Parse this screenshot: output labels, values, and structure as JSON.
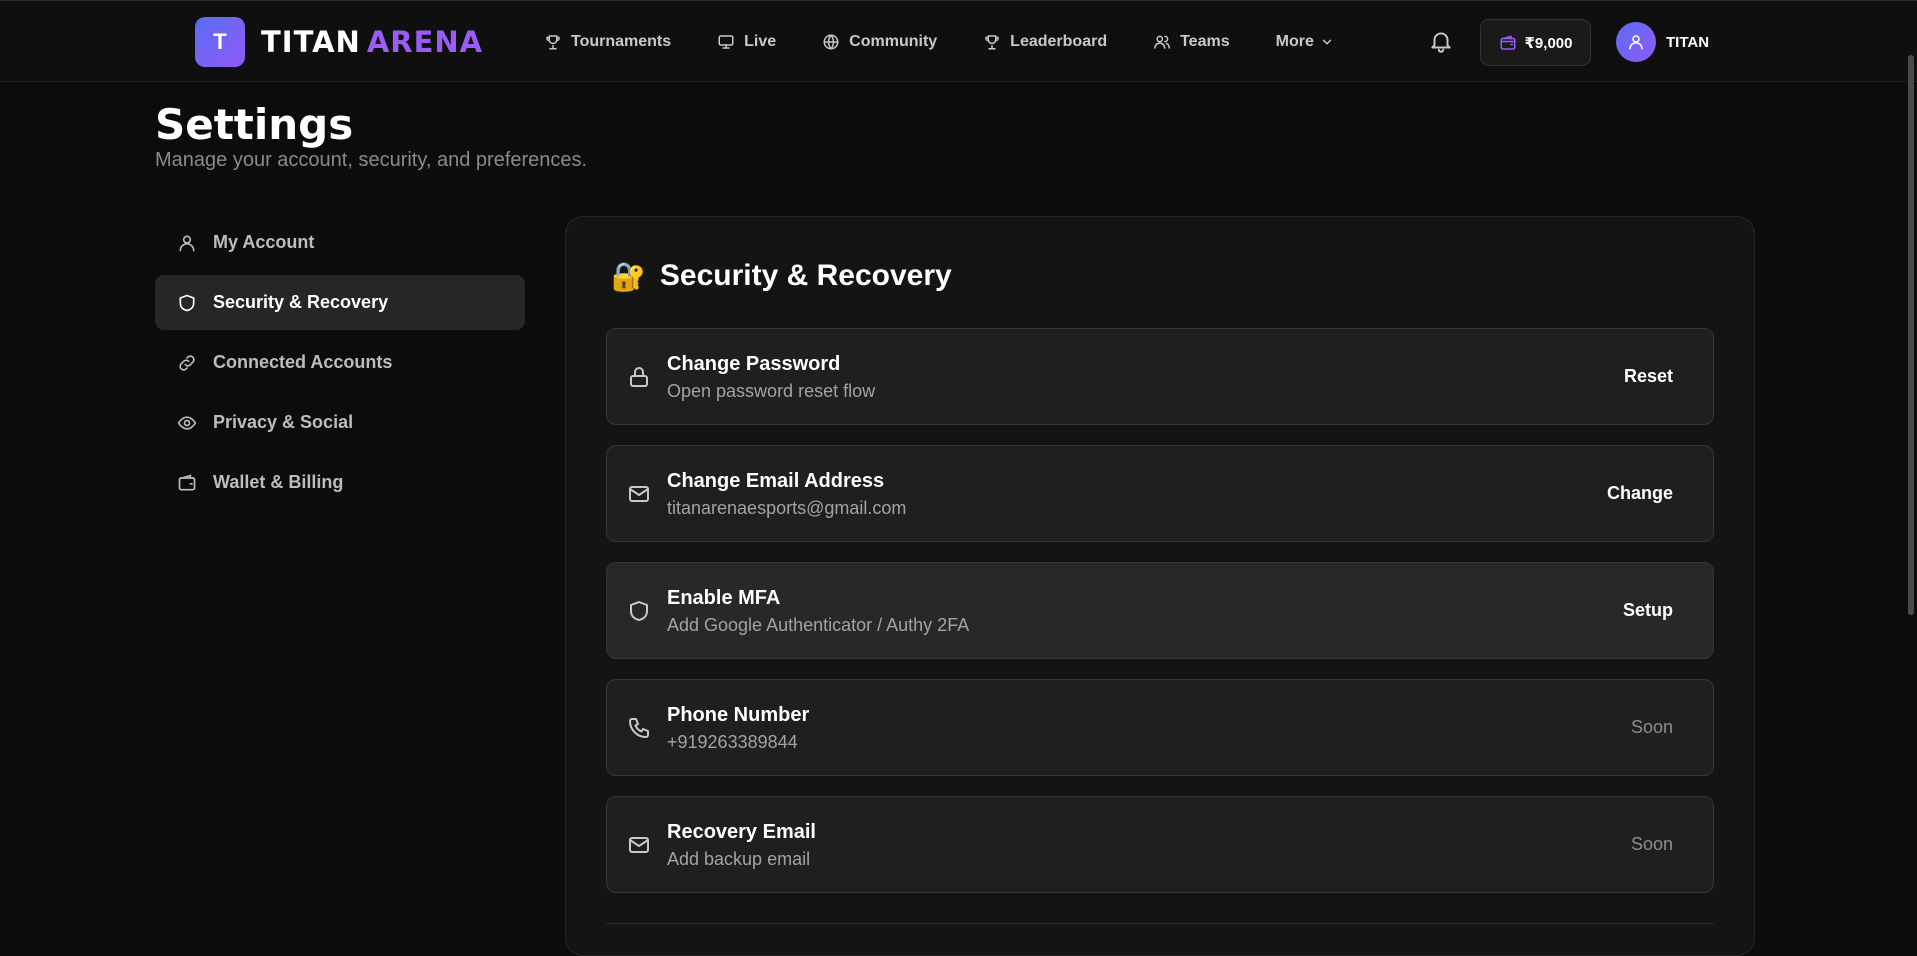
{
  "brand": {
    "mark": "T",
    "name_part1": "TITAN",
    "name_part2": "ARENA",
    "accent": "#9a5cf5"
  },
  "nav": {
    "items": [
      {
        "label": "Tournaments",
        "icon": "trophy-icon"
      },
      {
        "label": "Live",
        "icon": "monitor-icon"
      },
      {
        "label": "Community",
        "icon": "globe-icon"
      },
      {
        "label": "Leaderboard",
        "icon": "trophy-icon"
      },
      {
        "label": "Teams",
        "icon": "users-icon"
      },
      {
        "label": "More",
        "icon": "chevron-down-icon"
      }
    ],
    "wallet_balance": "₹9,000",
    "username": "TITAN"
  },
  "header": {
    "title": "Settings",
    "subtitle": "Manage your account, security, and preferences."
  },
  "sidebar": {
    "items": [
      {
        "label": "My Account",
        "icon": "user-icon",
        "active": false
      },
      {
        "label": "Security & Recovery",
        "icon": "shield-icon",
        "active": true
      },
      {
        "label": "Connected Accounts",
        "icon": "link-icon",
        "active": false
      },
      {
        "label": "Privacy & Social",
        "icon": "eye-icon",
        "active": false
      },
      {
        "label": "Wallet & Billing",
        "icon": "wallet-icon",
        "active": false
      }
    ]
  },
  "panel": {
    "emoji": "🔐",
    "title": "Security & Recovery",
    "rows": [
      {
        "title": "Change Password",
        "desc": "Open password reset flow",
        "action": "Reset",
        "icon": "lock-icon"
      },
      {
        "title": "Change Email Address",
        "desc": "titanarenaesports@gmail.com",
        "action": "Change",
        "icon": "mail-icon"
      },
      {
        "title": "Enable MFA",
        "desc": "Add Google Authenticator / Authy 2FA",
        "action": "Setup",
        "icon": "shield-icon"
      },
      {
        "title": "Phone Number",
        "desc": "+919263389844",
        "action": "Soon",
        "icon": "phone-icon"
      },
      {
        "title": "Recovery Email",
        "desc": "Add backup email",
        "action": "Soon",
        "icon": "mail-icon"
      }
    ]
  }
}
